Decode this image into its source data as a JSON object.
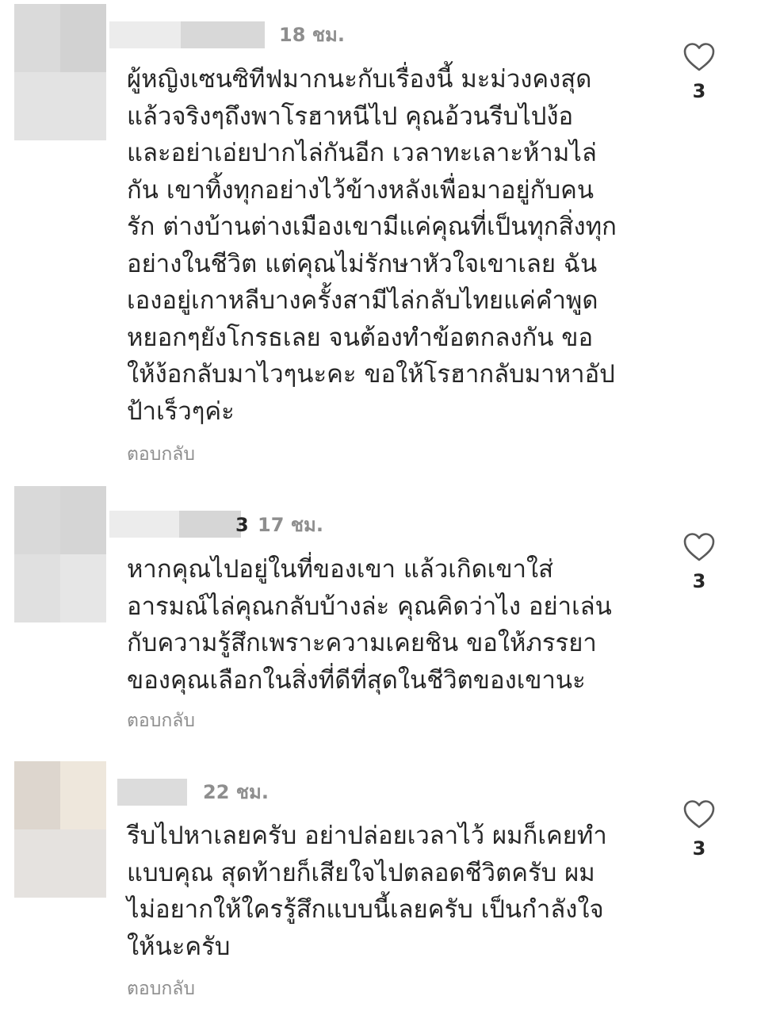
{
  "comments": [
    {
      "time": "18 ชม.",
      "text": "ผู้หญิงเซนซิทีฟมากนะกับเรื่องนี้ มะม่วงคงสุด\nแล้วจริงๆถึงพาโรฮาหนีไป คุณอ้วนรีบไปง้อ\nและอย่าเอ่ยปากไล่กันอีก เวลาทะเลาะห้ามไล่\nกัน เขาทิ้งทุกอย่างไว้ข้างหลังเพื่อมาอยู่กับคน\nรัก ต่างบ้านต่างเมืองเขามีแค่คุณที่เป็นทุกสิ่งทุก\nอย่างในชีวิต แต่คุณไม่รักษาหัวใจเขาเลย ฉัน\nเองอยู่เกาหลีบางครั้งสามีไล่กลับไทยแค่คำพูด\nหยอกๆยังโกรธเลย จนต้องทำข้อตกลงกัน ขอ\nให้ง้อกลับมาไวๆนะคะ ขอให้โรฮากลับมาหาอัป\nป้าเร็วๆค่ะ",
      "reply": "ตอบกลับ",
      "likes": "3"
    },
    {
      "time_prefix": "3",
      "time": "17 ชม.",
      "text": "หากคุณไปอยู่ในที่ของเขา แล้วเกิดเขาใส่\nอารมณ์ไล่คุณกลับบ้างล่ะ คุณคิดว่าไง อย่าเล่น\nกับความรู้สึกเพราะความเคยชิน ขอให้ภรรยา\nของคุณเลือกในสิ่งที่ดีที่สุดในชีวิตของเขานะ",
      "reply": "ตอบกลับ",
      "likes": "3"
    },
    {
      "time": "22 ชม.",
      "text": "รีบไปหาเลยครับ อย่าปล่อยเวลาไว้ ผมก็เคยทำ\nแบบคุณ สุดท้ายก็เสียใจไปตลอดชีวิตครับ ผม\nไม่อยากให้ใครรู้สึกแบบนี้เลยครับ เป็นกำลังใจ\nให้นะครับ",
      "reply": "ตอบกลับ",
      "likes": "3"
    }
  ],
  "icons": {
    "like": "heart-outline-icon"
  },
  "colors": {
    "text": "#262626",
    "meta": "#8e8e8e",
    "avatar_blur_1": "#d4d4d4",
    "avatar_blur_2": "#e8e8e8",
    "avatar_blur_3": "#d9d3cc",
    "avatar_blur_4": "#efe9e0"
  }
}
